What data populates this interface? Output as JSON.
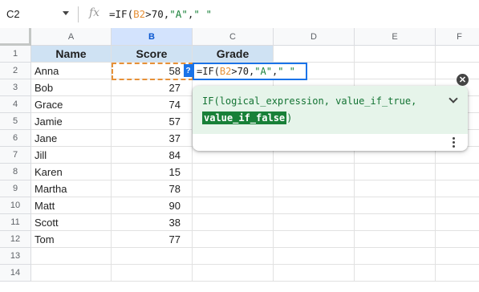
{
  "formula_bar": {
    "name_box": "C2",
    "fx": "fx",
    "formula_prefix": "=IF(",
    "formula_ref": "B2",
    "formula_mid": ">70,",
    "formula_str1": "\"A\"",
    "formula_comma": ",",
    "formula_str2": "\" \""
  },
  "columns": [
    "A",
    "B",
    "C",
    "D",
    "E",
    "F"
  ],
  "selected_column": "B",
  "rows": [
    "1",
    "2",
    "3",
    "4",
    "5",
    "6",
    "7",
    "8",
    "9",
    "10",
    "11",
    "12",
    "13",
    "14"
  ],
  "headers": {
    "name": "Name",
    "score": "Score",
    "grade": "Grade"
  },
  "data": [
    {
      "name": "Anna",
      "score": "58"
    },
    {
      "name": "Bob",
      "score": "27"
    },
    {
      "name": "Grace",
      "score": "74"
    },
    {
      "name": "Jamie",
      "score": "57"
    },
    {
      "name": "Jane",
      "score": "37"
    },
    {
      "name": "Jill",
      "score": "84"
    },
    {
      "name": "Karen",
      "score": "15"
    },
    {
      "name": "Martha",
      "score": "78"
    },
    {
      "name": "Matt",
      "score": "90"
    },
    {
      "name": "Scott",
      "score": "38"
    },
    {
      "name": "Tom",
      "score": "77"
    }
  ],
  "edit_cell": {
    "help_badge": "?",
    "prefix": "=IF(",
    "ref": "B2",
    "mid": ">70,",
    "str1": "\"A\"",
    "comma": ",",
    "str2": "\" \""
  },
  "tooltip": {
    "line1": "IF(logical_expression, value_if_true,",
    "highlight": "value_if_false",
    "close_paren": ")",
    "close_icon": "close-icon",
    "expand_icon": "chevron-down-icon",
    "more_icon": "more-vert-icon"
  },
  "colors": {
    "ref": "#e69138",
    "string": "#188038",
    "header_fill": "#cfe2f3",
    "selection": "#1a73e8"
  }
}
